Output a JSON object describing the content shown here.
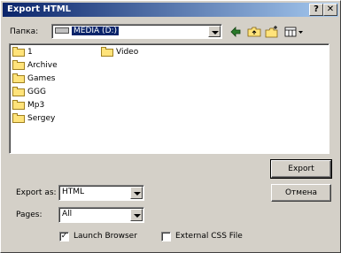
{
  "window": {
    "title": "Export HTML",
    "help_glyph": "?",
    "close_glyph": "✕"
  },
  "lookin": {
    "label": "Папка:",
    "value": "MEDIA (D:)"
  },
  "toolbar": {
    "back_icon": "back-arrow-icon",
    "up_icon": "up-folder-icon",
    "new_icon": "new-folder-icon",
    "view_icon": "view-menu-icon"
  },
  "files": [
    {
      "name": "1"
    },
    {
      "name": "Archive"
    },
    {
      "name": "Games"
    },
    {
      "name": "GGG"
    },
    {
      "name": "Mp3"
    },
    {
      "name": "Sergey"
    },
    {
      "name": "Video"
    }
  ],
  "buttons": {
    "export": "Export",
    "cancel": "Отмена"
  },
  "export_as": {
    "label": "Export as:",
    "value": "HTML"
  },
  "pages": {
    "label": "Pages:",
    "value": "All"
  },
  "options": {
    "launch_browser": "Launch Browser",
    "launch_checked": true,
    "external_css": "External CSS File",
    "css_checked": false
  }
}
